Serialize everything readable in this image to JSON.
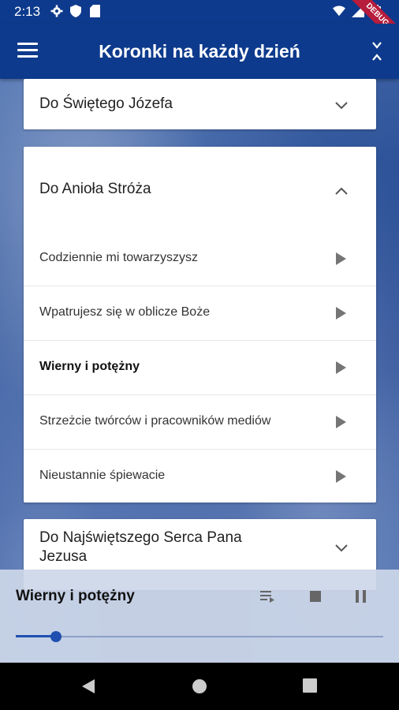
{
  "status": {
    "time": "2:13",
    "debug_label": "DEBUG"
  },
  "appbar": {
    "title": "Koronki na każdy dzień"
  },
  "sections": [
    {
      "title": "Do Świętego Józefa",
      "expanded": false
    },
    {
      "title": "Do Anioła Stróża",
      "expanded": true,
      "items": [
        {
          "label": "Codziennie mi towarzyszysz",
          "active": false
        },
        {
          "label": "Wpatrujesz się w oblicze Boże",
          "active": false
        },
        {
          "label": "Wierny i potężny",
          "active": true
        },
        {
          "label": "Strzeżcie twórców i pracowników mediów",
          "active": false
        },
        {
          "label": "Nieustannie śpiewacie",
          "active": false
        }
      ]
    },
    {
      "title_line1": "Do Najświętszego Serca Pana",
      "title_line2": "Jezusa",
      "expanded": false
    }
  ],
  "player": {
    "now_playing": "Wierny i potężny",
    "progress": 0.11
  },
  "icons": {
    "menu": "menu-icon",
    "collapse": "unfold-less-icon",
    "queue": "playlist-icon",
    "stop": "stop-icon",
    "pause": "pause-icon"
  },
  "colors": {
    "primary": "#0d3a8c",
    "accent": "#1f4fb0"
  }
}
